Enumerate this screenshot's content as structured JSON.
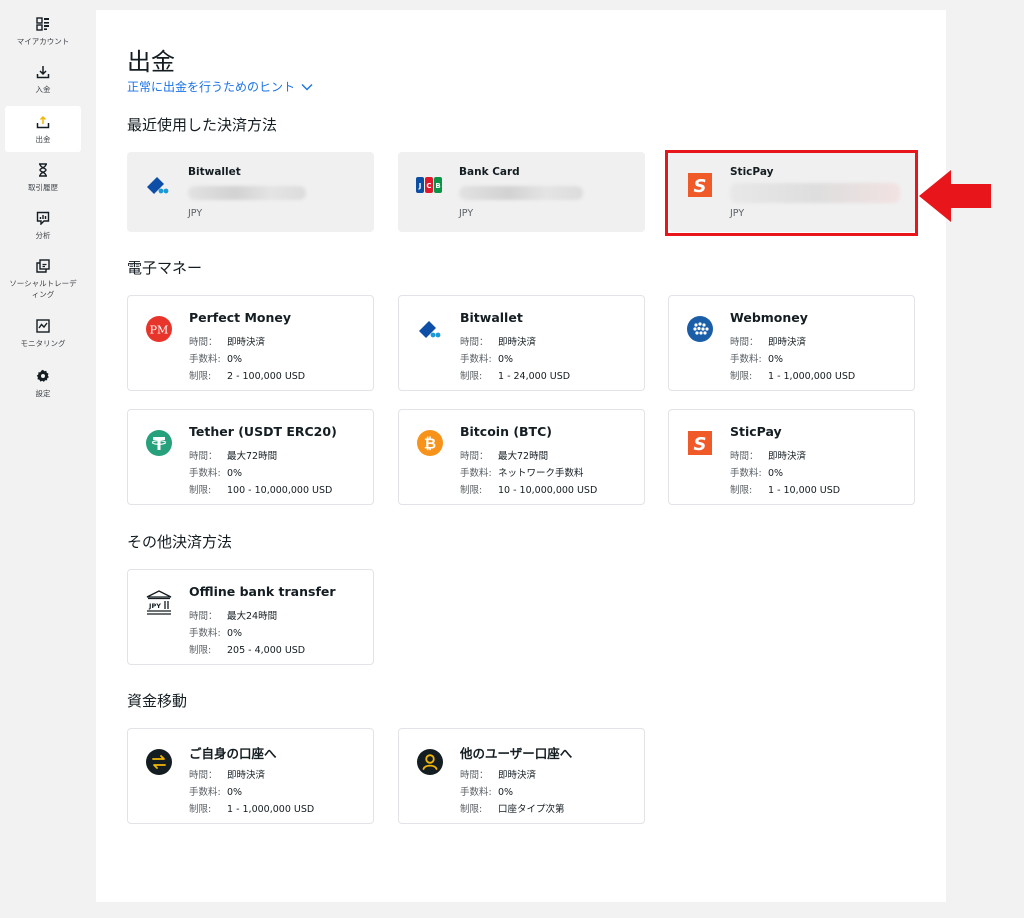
{
  "sidebar": {
    "items": [
      {
        "label": "マイアカウント",
        "icon": "grid-icon"
      },
      {
        "label": "入金",
        "icon": "download-icon"
      },
      {
        "label": "出金",
        "icon": "upload-icon",
        "active": true
      },
      {
        "label": "取引履歴",
        "icon": "hourglass-icon"
      },
      {
        "label": "分析",
        "icon": "chart-icon"
      },
      {
        "label": "ソーシャルトレーディング",
        "icon": "copy-icon"
      },
      {
        "label": "モニタリング",
        "icon": "monitor-icon"
      },
      {
        "label": "設定",
        "icon": "gear-icon"
      }
    ]
  },
  "main": {
    "title": "出金",
    "hint_link": "正常に出金を行うためのヒント",
    "recent": {
      "title": "最近使用した決済方法",
      "items": [
        {
          "name": "Bitwallet",
          "currency": "JPY",
          "icon": "bitwallet-icon"
        },
        {
          "name": "Bank Card",
          "currency": "JPY",
          "icon": "jcb-icon"
        },
        {
          "name": "SticPay",
          "currency": "JPY",
          "icon": "sticpay-icon"
        }
      ]
    },
    "labels": {
      "time": "時間：",
      "fee": "手数料:",
      "limit": "制限:"
    },
    "emoney": {
      "title": "電子マネー",
      "items": [
        {
          "name": "Perfect Money",
          "time": "即時決済",
          "fee": "0%",
          "limit": "2 - 100,000 USD"
        },
        {
          "name": "Bitwallet",
          "time": "即時決済",
          "fee": "0%",
          "limit": "1 - 24,000 USD"
        },
        {
          "name": "Webmoney",
          "time": "即時決済",
          "fee": "0%",
          "limit": "1 - 1,000,000 USD"
        },
        {
          "name": "Tether (USDT ERC20)",
          "time": "最大72時間",
          "fee": "0%",
          "limit": "100 - 10,000,000 USD"
        },
        {
          "name": "Bitcoin (BTC)",
          "time": "最大72時間",
          "fee": "ネットワーク手数料",
          "limit": "10 - 10,000,000 USD"
        },
        {
          "name": "SticPay",
          "time": "即時決済",
          "fee": "0%",
          "limit": "1 - 10,000 USD"
        }
      ]
    },
    "other": {
      "title": "その他決済方法",
      "items": [
        {
          "name": "Offline bank transfer",
          "time": "最大24時間",
          "fee": "0%",
          "limit": "205 - 4,000 USD",
          "icon_text": "JPY"
        }
      ]
    },
    "transfer": {
      "title": "資金移動",
      "items": [
        {
          "name": "ご自身の口座へ",
          "time": "即時決済",
          "fee": "0%",
          "limit": "1 - 1,000,000 USD"
        },
        {
          "name": "他のユーザー口座へ",
          "time": "即時決済",
          "fee": "0%",
          "limit": "口座タイプ次第"
        }
      ]
    }
  },
  "colors": {
    "accent": "#1a73e8",
    "highlight": "#e8161a",
    "sticpay": "#f05a28"
  }
}
